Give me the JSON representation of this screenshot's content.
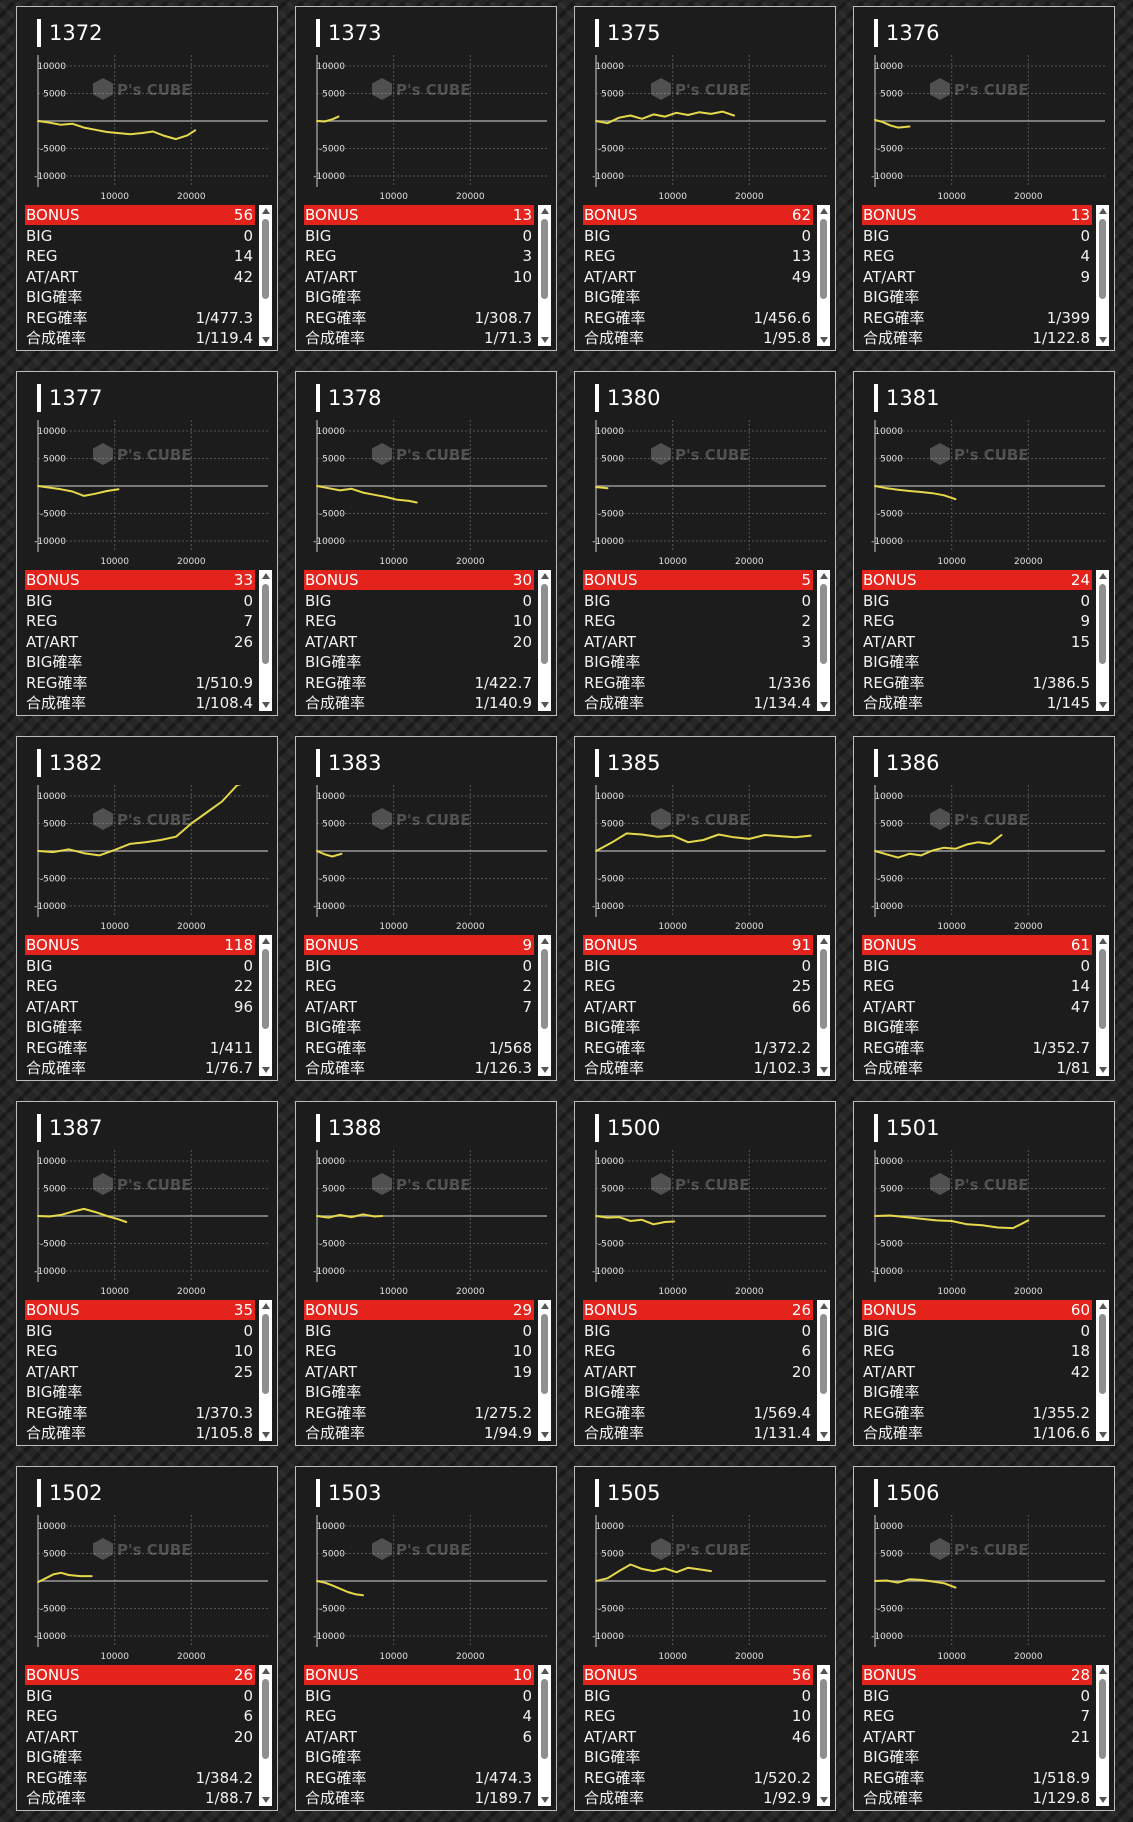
{
  "labels": {
    "bonus": "BONUS",
    "big": "BIG",
    "reg": "REG",
    "at": "AT/ART",
    "big_rate": "BIG確率",
    "reg_rate": "REG確率",
    "total_rate": "合成確率"
  },
  "watermark": "P's CUBE",
  "colors": {
    "line": "#e6d84a",
    "bonus_bar": "#e3231c",
    "card_border": "#bdbdbd"
  },
  "chart_data": [
    {
      "type": "line",
      "title": "1372",
      "xticks": [
        "10000",
        "20000"
      ],
      "yticks": [
        "10000",
        "5000",
        "-5000",
        "-10000"
      ],
      "xlim": [
        0,
        30000
      ],
      "ylim": [
        -12000,
        12000
      ],
      "series": [
        {
          "x": [
            0,
            1500,
            3000,
            4500,
            6000,
            7500,
            9000,
            10500,
            12000,
            13500,
            15000,
            16500,
            18000,
            19500,
            20500
          ],
          "y": [
            0,
            -300,
            -700,
            -500,
            -1200,
            -1600,
            -2000,
            -2200,
            -2400,
            -2200,
            -1900,
            -2700,
            -3300,
            -2600,
            -1700
          ]
        }
      ],
      "stats": {
        "bonus": "56",
        "big": "0",
        "reg": "14",
        "at": "42",
        "big_rate": "",
        "reg_rate": "1/477.3",
        "total_rate": "1/119.4"
      }
    },
    {
      "type": "line",
      "title": "1373",
      "xticks": [
        "10000",
        "20000"
      ],
      "yticks": [
        "10000",
        "5000",
        "-5000",
        "-10000"
      ],
      "xlim": [
        0,
        30000
      ],
      "ylim": [
        -12000,
        12000
      ],
      "series": [
        {
          "x": [
            0,
            1000,
            2000,
            2800
          ],
          "y": [
            0,
            -100,
            300,
            800
          ]
        }
      ],
      "stats": {
        "bonus": "13",
        "big": "0",
        "reg": "3",
        "at": "10",
        "big_rate": "",
        "reg_rate": "1/308.7",
        "total_rate": "1/71.3"
      }
    },
    {
      "type": "line",
      "title": "1375",
      "xticks": [
        "10000",
        "20000"
      ],
      "yticks": [
        "10000",
        "5000",
        "-5000",
        "-10000"
      ],
      "xlim": [
        0,
        30000
      ],
      "ylim": [
        -12000,
        12000
      ],
      "series": [
        {
          "x": [
            0,
            1500,
            3000,
            4500,
            6000,
            7500,
            9000,
            10500,
            12000,
            13500,
            15000,
            16500,
            18000
          ],
          "y": [
            0,
            -400,
            600,
            1000,
            400,
            1200,
            800,
            1500,
            1100,
            1600,
            1300,
            1700,
            1000
          ]
        }
      ],
      "stats": {
        "bonus": "62",
        "big": "0",
        "reg": "13",
        "at": "49",
        "big_rate": "",
        "reg_rate": "1/456.6",
        "total_rate": "1/95.8"
      }
    },
    {
      "type": "line",
      "title": "1376",
      "xticks": [
        "10000",
        "20000"
      ],
      "yticks": [
        "10000",
        "5000",
        "-5000",
        "-10000"
      ],
      "xlim": [
        0,
        30000
      ],
      "ylim": [
        -12000,
        12000
      ],
      "series": [
        {
          "x": [
            0,
            1000,
            2000,
            3000,
            4500
          ],
          "y": [
            200,
            -200,
            -800,
            -1200,
            -1000
          ]
        }
      ],
      "stats": {
        "bonus": "13",
        "big": "0",
        "reg": "4",
        "at": "9",
        "big_rate": "",
        "reg_rate": "1/399",
        "total_rate": "1/122.8"
      }
    },
    {
      "type": "line",
      "title": "1377",
      "xticks": [
        "10000",
        "20000"
      ],
      "yticks": [
        "10000",
        "5000",
        "-5000",
        "-10000"
      ],
      "xlim": [
        0,
        30000
      ],
      "ylim": [
        -12000,
        12000
      ],
      "series": [
        {
          "x": [
            0,
            1500,
            3000,
            4500,
            6000,
            7500,
            9000,
            10500
          ],
          "y": [
            0,
            -300,
            -600,
            -1000,
            -1800,
            -1400,
            -900,
            -600
          ]
        }
      ],
      "stats": {
        "bonus": "33",
        "big": "0",
        "reg": "7",
        "at": "26",
        "big_rate": "",
        "reg_rate": "1/510.9",
        "total_rate": "1/108.4"
      }
    },
    {
      "type": "line",
      "title": "1378",
      "xticks": [
        "10000",
        "20000"
      ],
      "yticks": [
        "10000",
        "5000",
        "-5000",
        "-10000"
      ],
      "xlim": [
        0,
        30000
      ],
      "ylim": [
        -12000,
        12000
      ],
      "series": [
        {
          "x": [
            0,
            1500,
            3000,
            4500,
            6000,
            7500,
            9000,
            10500,
            12000,
            13000
          ],
          "y": [
            0,
            -400,
            -800,
            -500,
            -1200,
            -1600,
            -2000,
            -2500,
            -2700,
            -3000
          ]
        }
      ],
      "stats": {
        "bonus": "30",
        "big": "0",
        "reg": "10",
        "at": "20",
        "big_rate": "",
        "reg_rate": "1/422.7",
        "total_rate": "1/140.9"
      }
    },
    {
      "type": "line",
      "title": "1380",
      "xticks": [
        "10000",
        "20000"
      ],
      "yticks": [
        "10000",
        "5000",
        "-5000",
        "-10000"
      ],
      "xlim": [
        0,
        30000
      ],
      "ylim": [
        -12000,
        12000
      ],
      "series": [
        {
          "x": [
            0,
            800,
            1500
          ],
          "y": [
            -200,
            -300,
            -400
          ]
        }
      ],
      "stats": {
        "bonus": "5",
        "big": "0",
        "reg": "2",
        "at": "3",
        "big_rate": "",
        "reg_rate": "1/336",
        "total_rate": "1/134.4"
      }
    },
    {
      "type": "line",
      "title": "1381",
      "xticks": [
        "10000",
        "20000"
      ],
      "yticks": [
        "10000",
        "5000",
        "-5000",
        "-10000"
      ],
      "xlim": [
        0,
        30000
      ],
      "ylim": [
        -12000,
        12000
      ],
      "series": [
        {
          "x": [
            0,
            1500,
            3000,
            4500,
            6000,
            7500,
            9000,
            10500
          ],
          "y": [
            0,
            -400,
            -700,
            -900,
            -1100,
            -1300,
            -1700,
            -2400
          ]
        }
      ],
      "stats": {
        "bonus": "24",
        "big": "0",
        "reg": "9",
        "at": "15",
        "big_rate": "",
        "reg_rate": "1/386.5",
        "total_rate": "1/145"
      }
    },
    {
      "type": "line",
      "title": "1382",
      "xticks": [
        "10000",
        "20000"
      ],
      "yticks": [
        "10000",
        "5000",
        "-5000",
        "-10000"
      ],
      "xlim": [
        0,
        30000
      ],
      "ylim": [
        -12000,
        12000
      ],
      "series": [
        {
          "x": [
            0,
            2000,
            4000,
            6000,
            8000,
            10000,
            12000,
            14000,
            16000,
            18000,
            20000,
            22000,
            24000,
            26000,
            27500
          ],
          "y": [
            0,
            -200,
            300,
            -400,
            -800,
            200,
            1300,
            1600,
            2000,
            2600,
            5000,
            7000,
            9000,
            12000,
            12500
          ]
        }
      ],
      "stats": {
        "bonus": "118",
        "big": "0",
        "reg": "22",
        "at": "96",
        "big_rate": "",
        "reg_rate": "1/411",
        "total_rate": "1/76.7"
      }
    },
    {
      "type": "line",
      "title": "1383",
      "xticks": [
        "10000",
        "20000"
      ],
      "yticks": [
        "10000",
        "5000",
        "-5000",
        "-10000"
      ],
      "xlim": [
        0,
        30000
      ],
      "ylim": [
        -12000,
        12000
      ],
      "series": [
        {
          "x": [
            0,
            1000,
            2000,
            3200
          ],
          "y": [
            0,
            -600,
            -1000,
            -500
          ]
        }
      ],
      "stats": {
        "bonus": "9",
        "big": "0",
        "reg": "2",
        "at": "7",
        "big_rate": "",
        "reg_rate": "1/568",
        "total_rate": "1/126.3"
      }
    },
    {
      "type": "line",
      "title": "1385",
      "xticks": [
        "10000",
        "20000"
      ],
      "yticks": [
        "10000",
        "5000",
        "-5000",
        "-10000"
      ],
      "xlim": [
        0,
        30000
      ],
      "ylim": [
        -12000,
        12000
      ],
      "series": [
        {
          "x": [
            0,
            2000,
            4000,
            6000,
            8000,
            10000,
            12000,
            14000,
            16000,
            18000,
            20000,
            22000,
            24000,
            26000,
            28000
          ],
          "y": [
            0,
            1500,
            3200,
            3000,
            2600,
            2800,
            1600,
            2000,
            3000,
            2500,
            2200,
            2900,
            2700,
            2500,
            2800
          ]
        }
      ],
      "stats": {
        "bonus": "91",
        "big": "0",
        "reg": "25",
        "at": "66",
        "big_rate": "",
        "reg_rate": "1/372.2",
        "total_rate": "1/102.3"
      }
    },
    {
      "type": "line",
      "title": "1386",
      "xticks": [
        "10000",
        "20000"
      ],
      "yticks": [
        "10000",
        "5000",
        "-5000",
        "-10000"
      ],
      "xlim": [
        0,
        30000
      ],
      "ylim": [
        -12000,
        12000
      ],
      "series": [
        {
          "x": [
            0,
            1500,
            3000,
            4500,
            6000,
            7500,
            9000,
            10500,
            12000,
            13500,
            15000,
            16500
          ],
          "y": [
            0,
            -600,
            -1200,
            -500,
            -800,
            100,
            600,
            400,
            1200,
            1600,
            1300,
            2900
          ]
        }
      ],
      "stats": {
        "bonus": "61",
        "big": "0",
        "reg": "14",
        "at": "47",
        "big_rate": "",
        "reg_rate": "1/352.7",
        "total_rate": "1/81"
      }
    },
    {
      "type": "line",
      "title": "1387",
      "xticks": [
        "10000",
        "20000"
      ],
      "yticks": [
        "10000",
        "5000",
        "-5000",
        "-10000"
      ],
      "xlim": [
        0,
        30000
      ],
      "ylim": [
        -12000,
        12000
      ],
      "series": [
        {
          "x": [
            0,
            1500,
            3000,
            4500,
            6000,
            7500,
            9000,
            10500,
            11500
          ],
          "y": [
            0,
            -100,
            200,
            800,
            1300,
            700,
            0,
            -600,
            -1100
          ]
        }
      ],
      "stats": {
        "bonus": "35",
        "big": "0",
        "reg": "10",
        "at": "25",
        "big_rate": "",
        "reg_rate": "1/370.3",
        "total_rate": "1/105.8"
      }
    },
    {
      "type": "line",
      "title": "1388",
      "xticks": [
        "10000",
        "20000"
      ],
      "yticks": [
        "10000",
        "5000",
        "-5000",
        "-10000"
      ],
      "xlim": [
        0,
        30000
      ],
      "ylim": [
        -12000,
        12000
      ],
      "series": [
        {
          "x": [
            0,
            1500,
            3000,
            4500,
            6000,
            7500,
            8500
          ],
          "y": [
            0,
            -300,
            200,
            -200,
            300,
            -100,
            0
          ]
        }
      ],
      "stats": {
        "bonus": "29",
        "big": "0",
        "reg": "10",
        "at": "19",
        "big_rate": "",
        "reg_rate": "1/275.2",
        "total_rate": "1/94.9"
      }
    },
    {
      "type": "line",
      "title": "1500",
      "xticks": [
        "10000",
        "20000"
      ],
      "yticks": [
        "10000",
        "5000",
        "-5000",
        "-10000"
      ],
      "xlim": [
        0,
        30000
      ],
      "ylim": [
        -12000,
        12000
      ],
      "series": [
        {
          "x": [
            0,
            1500,
            3000,
            4500,
            6000,
            7500,
            9000,
            10200
          ],
          "y": [
            0,
            -300,
            -200,
            -900,
            -700,
            -1500,
            -1100,
            -1000
          ]
        }
      ],
      "stats": {
        "bonus": "26",
        "big": "0",
        "reg": "6",
        "at": "20",
        "big_rate": "",
        "reg_rate": "1/569.4",
        "total_rate": "1/131.4"
      }
    },
    {
      "type": "line",
      "title": "1501",
      "xticks": [
        "10000",
        "20000"
      ],
      "yticks": [
        "10000",
        "5000",
        "-5000",
        "-10000"
      ],
      "xlim": [
        0,
        30000
      ],
      "ylim": [
        -12000,
        12000
      ],
      "series": [
        {
          "x": [
            0,
            2000,
            4000,
            6000,
            8000,
            10000,
            12000,
            14000,
            16000,
            18000,
            19000,
            20000
          ],
          "y": [
            0,
            100,
            -200,
            -500,
            -800,
            -900,
            -1500,
            -1700,
            -2100,
            -2200,
            -1500,
            -800
          ]
        }
      ],
      "stats": {
        "bonus": "60",
        "big": "0",
        "reg": "18",
        "at": "42",
        "big_rate": "",
        "reg_rate": "1/355.2",
        "total_rate": "1/106.6"
      }
    },
    {
      "type": "line",
      "title": "1502",
      "xticks": [
        "10000",
        "20000"
      ],
      "yticks": [
        "10000",
        "5000",
        "-5000",
        "-10000"
      ],
      "xlim": [
        0,
        30000
      ],
      "ylim": [
        -12000,
        12000
      ],
      "series": [
        {
          "x": [
            0,
            1000,
            2000,
            3000,
            4000,
            5500,
            7000
          ],
          "y": [
            -200,
            500,
            1200,
            1500,
            1100,
            900,
            900
          ]
        }
      ],
      "stats": {
        "bonus": "26",
        "big": "0",
        "reg": "6",
        "at": "20",
        "big_rate": "",
        "reg_rate": "1/384.2",
        "total_rate": "1/88.7"
      }
    },
    {
      "type": "line",
      "title": "1503",
      "xticks": [
        "10000",
        "20000"
      ],
      "yticks": [
        "10000",
        "5000",
        "-5000",
        "-10000"
      ],
      "xlim": [
        0,
        30000
      ],
      "ylim": [
        -12000,
        12000
      ],
      "series": [
        {
          "x": [
            0,
            1000,
            2000,
            3000,
            4000,
            5000,
            6000
          ],
          "y": [
            0,
            -300,
            -800,
            -1400,
            -2000,
            -2400,
            -2600
          ]
        }
      ],
      "stats": {
        "bonus": "10",
        "big": "0",
        "reg": "4",
        "at": "6",
        "big_rate": "",
        "reg_rate": "1/474.3",
        "total_rate": "1/189.7"
      }
    },
    {
      "type": "line",
      "title": "1505",
      "xticks": [
        "10000",
        "20000"
      ],
      "yticks": [
        "10000",
        "5000",
        "-5000",
        "-10000"
      ],
      "xlim": [
        0,
        30000
      ],
      "ylim": [
        -12000,
        12000
      ],
      "series": [
        {
          "x": [
            0,
            1500,
            3000,
            4500,
            6000,
            7500,
            9000,
            10500,
            12000,
            13500,
            15000
          ],
          "y": [
            0,
            500,
            1800,
            3000,
            2200,
            1800,
            2300,
            1600,
            2400,
            2100,
            1800
          ]
        }
      ],
      "stats": {
        "bonus": "56",
        "big": "0",
        "reg": "10",
        "at": "46",
        "big_rate": "",
        "reg_rate": "1/520.2",
        "total_rate": "1/92.9"
      }
    },
    {
      "type": "line",
      "title": "1506",
      "xticks": [
        "10000",
        "20000"
      ],
      "yticks": [
        "10000",
        "5000",
        "-5000",
        "-10000"
      ],
      "xlim": [
        0,
        30000
      ],
      "ylim": [
        -12000,
        12000
      ],
      "series": [
        {
          "x": [
            0,
            1500,
            3000,
            4500,
            6000,
            7500,
            9000,
            10500
          ],
          "y": [
            0,
            100,
            -300,
            300,
            200,
            -100,
            -400,
            -1200
          ]
        }
      ],
      "stats": {
        "bonus": "28",
        "big": "0",
        "reg": "7",
        "at": "21",
        "big_rate": "",
        "reg_rate": "1/518.9",
        "total_rate": "1/129.8"
      }
    }
  ]
}
